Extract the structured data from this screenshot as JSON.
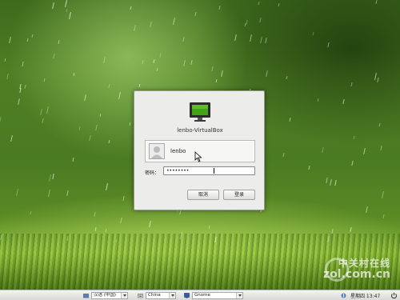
{
  "wallpaper": {
    "description_colors": {
      "top": "#3e6a1c",
      "glow": "#cdf06e",
      "grass": "#8ab83a"
    }
  },
  "watermark": {
    "cn": "中关村在线",
    "en": "zol.com.cn"
  },
  "login": {
    "hostname": "lenbo-VirtualBox",
    "user": {
      "name": "lenbo"
    },
    "password_label": "密码：",
    "password_value": "••••••••",
    "cancel_label": "取消",
    "login_label": "登录",
    "accent_color": "#43a317"
  },
  "panel": {
    "language": "汉语 (中国)",
    "region": "China",
    "session": "Gnome",
    "clock": "星期四 13:47"
  }
}
